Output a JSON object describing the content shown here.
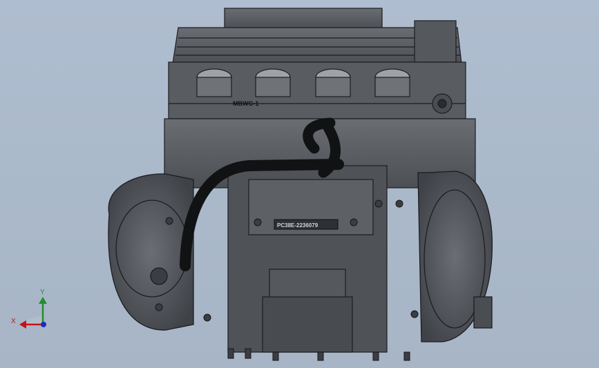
{
  "viewport": {
    "background": "#a9b7c9"
  },
  "model": {
    "engraving_head": "MBWG-1",
    "engraving_plate": "PC38E-2236079",
    "body_color": "#5a5d62",
    "edge_color": "#1c1d20",
    "hose_color": "#111214"
  },
  "triad": {
    "x_label": "X",
    "y_label": "Y",
    "x_color": "#c0141a",
    "y_color": "#1f8f2a",
    "z_color": "#1431b8"
  }
}
